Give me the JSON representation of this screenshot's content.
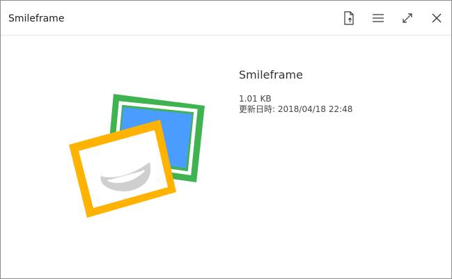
{
  "window": {
    "title": "Smileframe",
    "controls": [
      {
        "name": "open-file",
        "icon": "file-open-icon"
      },
      {
        "name": "menu",
        "icon": "hamburger-menu-icon"
      },
      {
        "name": "maximize",
        "icon": "expand-icon"
      },
      {
        "name": "close",
        "icon": "close-icon"
      }
    ]
  },
  "main": {
    "app_name": "Smileframe",
    "file_size": "1.01 KB",
    "modified_label": "更新日時",
    "modified_value": "2018/04/18 22:48"
  },
  "logo": {
    "back_frame_color": "#3fb34f",
    "back_photo_color": "#4a9cff",
    "front_frame_color": "#ffb300",
    "smile_color": "#cfcfcf"
  }
}
